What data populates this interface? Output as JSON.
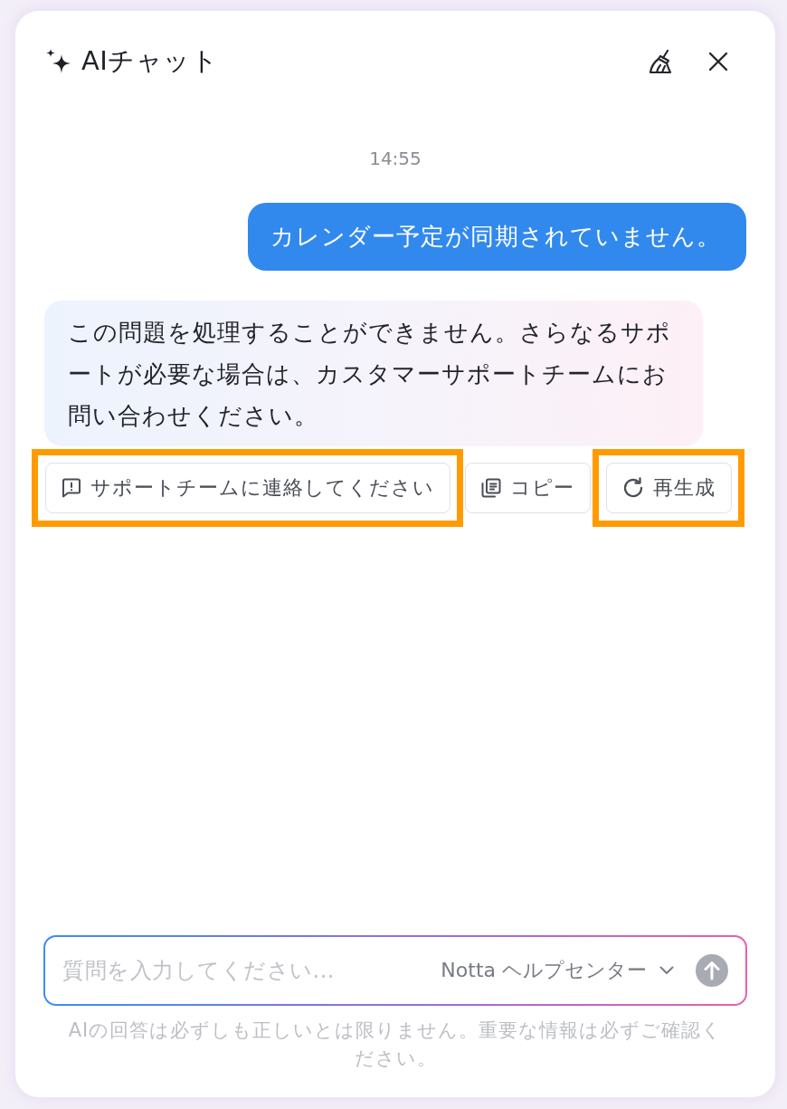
{
  "header": {
    "title": "AIチャット"
  },
  "conversation": {
    "timestamp": "14:55",
    "messages": [
      {
        "kind": "user",
        "text": "カレンダー予定が同期されていません。"
      },
      {
        "kind": "assistant",
        "text": "この問題を処理することができません。さらなるサポートが必要な場合は、カスタマーサポートチームにお問い合わせください。"
      }
    ]
  },
  "actions": [
    {
      "kind": "contact",
      "label": "サポートチームに連絡してください",
      "highlighted": true
    },
    {
      "kind": "copy",
      "label": "コピー",
      "highlighted": false
    },
    {
      "kind": "regenerate",
      "label": "再生成",
      "highlighted": true
    }
  ],
  "composer": {
    "placeholder": "質問を入力してください...",
    "source": "Notta ヘルプセンター"
  },
  "disclaimer": "AIの回答は必ずしも正しいとは限りません。重要な情報は必ずご確認ください。"
}
